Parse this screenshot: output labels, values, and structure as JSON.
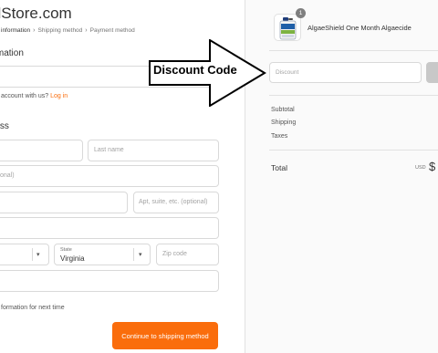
{
  "store": {
    "name": "olStore.com"
  },
  "breadcrumb": {
    "items": [
      "information",
      "Shipping method",
      "Payment method"
    ],
    "separator": "›"
  },
  "contact": {
    "title": "ormation",
    "account_prompt": "account with us?",
    "login_link": "Log in"
  },
  "shipping": {
    "title": "ress",
    "last_name_placeholder": "Last name",
    "company_placeholder": "onal)",
    "apartment_placeholder": "Apt, suite, etc. (optional)",
    "state_label": "State",
    "state_value": "Virginia",
    "zip_placeholder": "Zip code",
    "save_info": "formation for next time",
    "continue_button": "Continue to shipping method"
  },
  "order": {
    "product_name": "AlgaeShield One Month Algaecide",
    "quantity": "1",
    "discount_placeholder": "Discount",
    "subtotal_label": "Subtotal",
    "shipping_label": "Shipping",
    "taxes_label": "Taxes",
    "total_label": "Total",
    "currency": "USD",
    "total_amount": "$"
  },
  "annotation": {
    "text": "Discount Code"
  },
  "colors": {
    "accent": "#fa6d0c",
    "border": "#d9d9d9",
    "sidebar_bg": "#fafafa",
    "badge": "#7f7f7f"
  }
}
